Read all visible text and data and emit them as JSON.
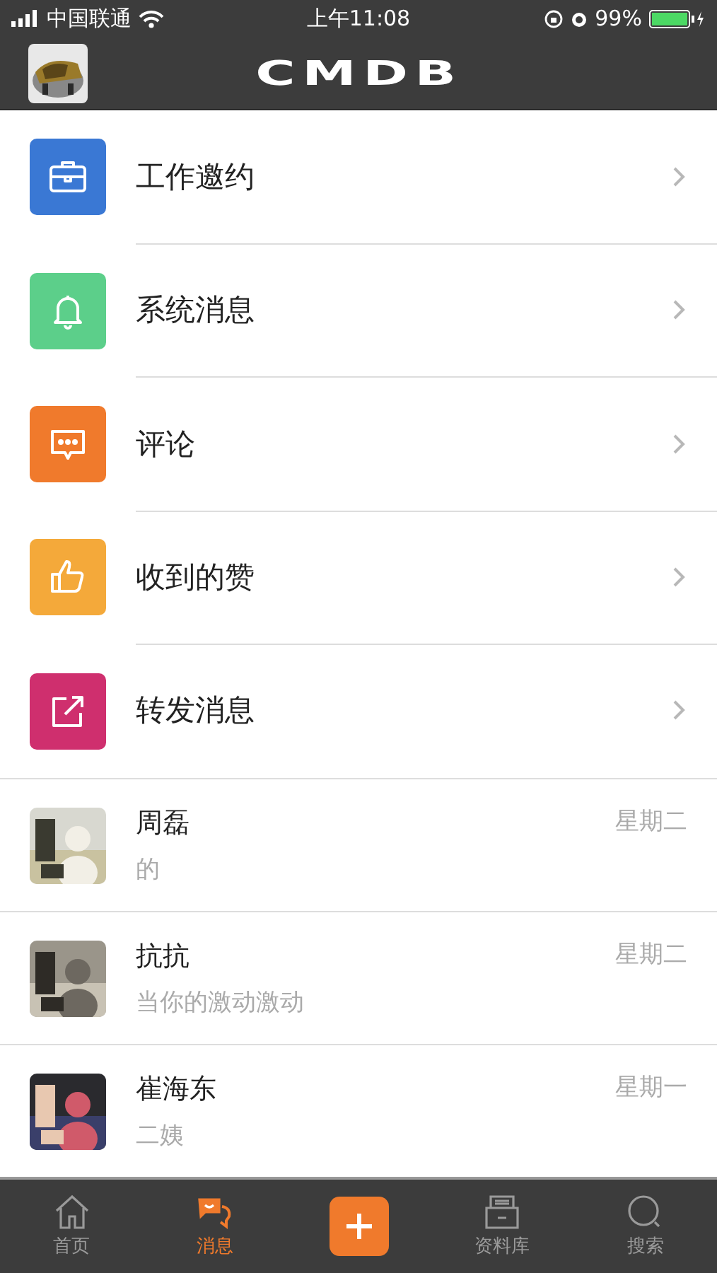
{
  "status_bar": {
    "carrier": "中国联通",
    "time": "上午11:08",
    "battery": "99%"
  },
  "header": {
    "logo": "CMDB"
  },
  "menu": [
    {
      "kind": "briefcase",
      "color": "#3a78d4",
      "label": "工作邀约"
    },
    {
      "kind": "bell",
      "color": "#5ccf8a",
      "label": "系统消息"
    },
    {
      "kind": "comment",
      "color": "#f07a2c",
      "label": "评论"
    },
    {
      "kind": "thumb",
      "color": "#f4a93a",
      "label": "收到的赞"
    },
    {
      "kind": "share",
      "color": "#cf2f6e",
      "label": "转发消息"
    }
  ],
  "chats": [
    {
      "name": "周磊",
      "preview": "的",
      "time": "星期二"
    },
    {
      "name": "抗抗",
      "preview": "当你的激动激动",
      "time": "星期二"
    },
    {
      "name": "崔海东",
      "preview": "二姨",
      "time": "星期一"
    }
  ],
  "tab_bar": [
    {
      "kind": "home",
      "label": "首页",
      "selected": false
    },
    {
      "kind": "chat",
      "label": "消息",
      "selected": true
    },
    {
      "kind": "compose",
      "selected": false
    },
    {
      "kind": "drawer",
      "label": "资料库",
      "selected": false
    },
    {
      "kind": "search",
      "label": "搜索",
      "selected": false
    }
  ]
}
